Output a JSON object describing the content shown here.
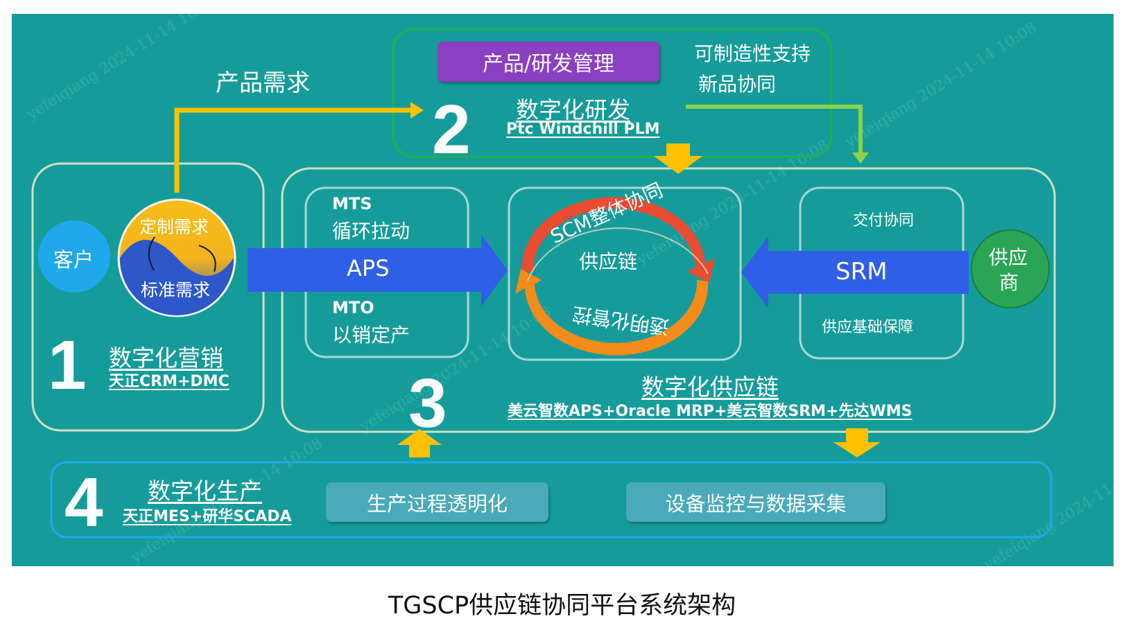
{
  "caption": "TGSCP供应链协同平台系统架构",
  "watermark": "yefeiqiang 2024-11-14 10:08",
  "colors": {
    "background": "#159c9a",
    "arrow_yellow": "#ffc000",
    "arrow_green": "#8bd14a",
    "arrow_blue": "#2f5fe6",
    "rd_frame": "#1fb24a",
    "pill_purple": "#8b3fc2",
    "cycle_red": "#e94b33",
    "cycle_orange": "#f58b1a",
    "customer_blue": "#1fa8ea",
    "supplier_green": "#2aa556"
  },
  "marketing": {
    "number": "1",
    "customer": "客户",
    "custom_demand": "定制需求",
    "standard_demand": "标准需求",
    "title": "数字化营销",
    "subtitle": "天正CRM+DMC"
  },
  "rd": {
    "number": "2",
    "product_demand": "产品需求",
    "pill": "产品/研发管理",
    "title": "数字化研发",
    "subtitle": "Ptc Windchill PLM",
    "note_line1": "可制造性支持",
    "note_line2": "新品协同"
  },
  "supply_chain": {
    "number": "3",
    "mts_title": "MTS",
    "mts_desc": "循环拉动",
    "aps": "APS",
    "mto_title": "MTO",
    "mto_desc": "以销定产",
    "scm_arc": "SCM整体协同",
    "center": "供应链",
    "transparent_arc": "透明化管控",
    "delivery": "交付协同",
    "srm": "SRM",
    "supply_base": "供应基础保障",
    "supplier_line1": "供应",
    "supplier_line2": "商",
    "title": "数字化供应链",
    "subtitle": "美云智数APS+Oracle MRP+美云智数SRM+先达WMS"
  },
  "production": {
    "number": "4",
    "title": "数字化生产",
    "subtitle": "天正MES+研华SCADA",
    "pill1": "生产过程透明化",
    "pill2": "设备监控与数据采集"
  }
}
